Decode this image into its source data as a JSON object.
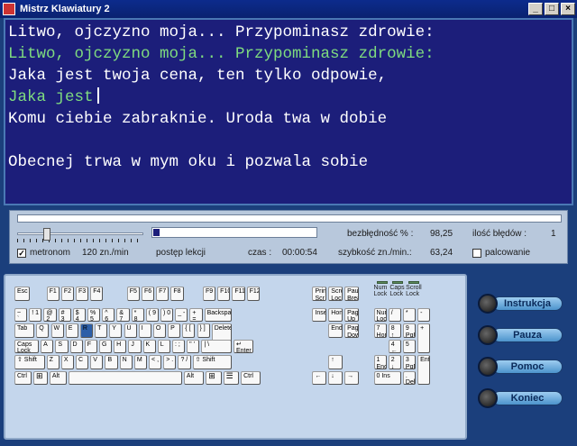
{
  "window": {
    "title": "Mistrz Klawiatury 2",
    "controls": {
      "minimize": "_",
      "maximize": "□",
      "close": "×"
    }
  },
  "text": {
    "lines": [
      {
        "text": "Litwo, ojczyzno moja... Przypominasz zdrowie:",
        "typed": false
      },
      {
        "text": "Litwo, ojczyzno moja... Przypominasz zdrowie:",
        "typed": true
      },
      {
        "text": "Jaka jest twoja cena, ten tylko odpowie,",
        "typed": false
      },
      {
        "text": "Jaka jest",
        "typed": true,
        "cursor": true
      },
      {
        "text": "Komu ciebie zabraknie. Uroda twa w dobie",
        "typed": false
      },
      {
        "text": "",
        "typed": false
      },
      {
        "text": "Obecnej trwa w mym oku i pozwala sobie",
        "typed": false
      }
    ]
  },
  "status": {
    "progress_fraction": 0.0,
    "metronome_label": "metronom",
    "metronome_checked": true,
    "metronome_rate": "120 zn./min",
    "metronome_level": 0.22,
    "lesson_label": "postęp lekcji",
    "lesson_progress": 0.04,
    "time_label": "czas :",
    "time_value": "00:00:54",
    "accuracy_label": "bezbłędność % :",
    "accuracy_value": "98,25",
    "errors_label": "ilość błędów :",
    "errors_value": "1",
    "speed_label": "szybkość zn./min.:",
    "speed_value": "63,24",
    "finger_label": "palcowanie",
    "finger_checked": false
  },
  "keyboard": {
    "highlight": "R",
    "leds": [
      "Num Lock",
      "Caps Lock",
      "Scroll Lock"
    ],
    "rows": [
      [
        "Esc",
        "F1",
        "F2",
        "F3",
        "F4",
        "F5",
        "F6",
        "F7",
        "F8",
        "F9",
        "F10",
        "F11",
        "F12",
        "Print Scr",
        "Scroll Lock",
        "Pause Break"
      ],
      [
        "~ `",
        "! 1",
        "@ 2",
        "# 3",
        "$ 4",
        "% 5",
        "^ 6",
        "& 7",
        "* 8",
        "( 9",
        ") 0",
        "_ -",
        "+ =",
        "Backspace",
        "Insert",
        "Home",
        "Page Up",
        "Num Lock",
        "/",
        "*",
        "-"
      ],
      [
        "Tab",
        "Q",
        "W",
        "E",
        "R",
        "T",
        "Y",
        "U",
        "I",
        "O",
        "P",
        "{ [",
        "} ]",
        "Delete",
        "End",
        "Page Down",
        "7 Home",
        "8 ↑",
        "9 PgUp",
        "+"
      ],
      [
        "Caps Lock",
        "A",
        "S",
        "D",
        "F",
        "G",
        "H",
        "J",
        "K",
        "L",
        ": ;",
        "\" '",
        "| \\",
        "↵ Enter",
        "4 ←",
        "5",
        "6 →"
      ],
      [
        "⇧ Shift",
        "Z",
        "X",
        "C",
        "V",
        "B",
        "N",
        "M",
        "< ,",
        "> .",
        "? /",
        "⇧ Shift",
        "↑",
        "1 End",
        "2 ↓",
        "3 PgDn",
        "Enter"
      ],
      [
        "Ctrl",
        "win-icon",
        "Alt",
        "Alt",
        "win-icon",
        "menu-icon",
        "Ctrl",
        "←",
        "↓",
        "→",
        "0 Ins",
        ". Del"
      ]
    ]
  },
  "side_buttons": [
    "Instrukcja",
    "Pauza",
    "Pomoc",
    "Koniec"
  ],
  "colors": {
    "text_bg": "#1c1e7a",
    "typed": "#7fdc7f",
    "panel": "#b8c8dc",
    "window_bg": "#1b3f7c"
  }
}
